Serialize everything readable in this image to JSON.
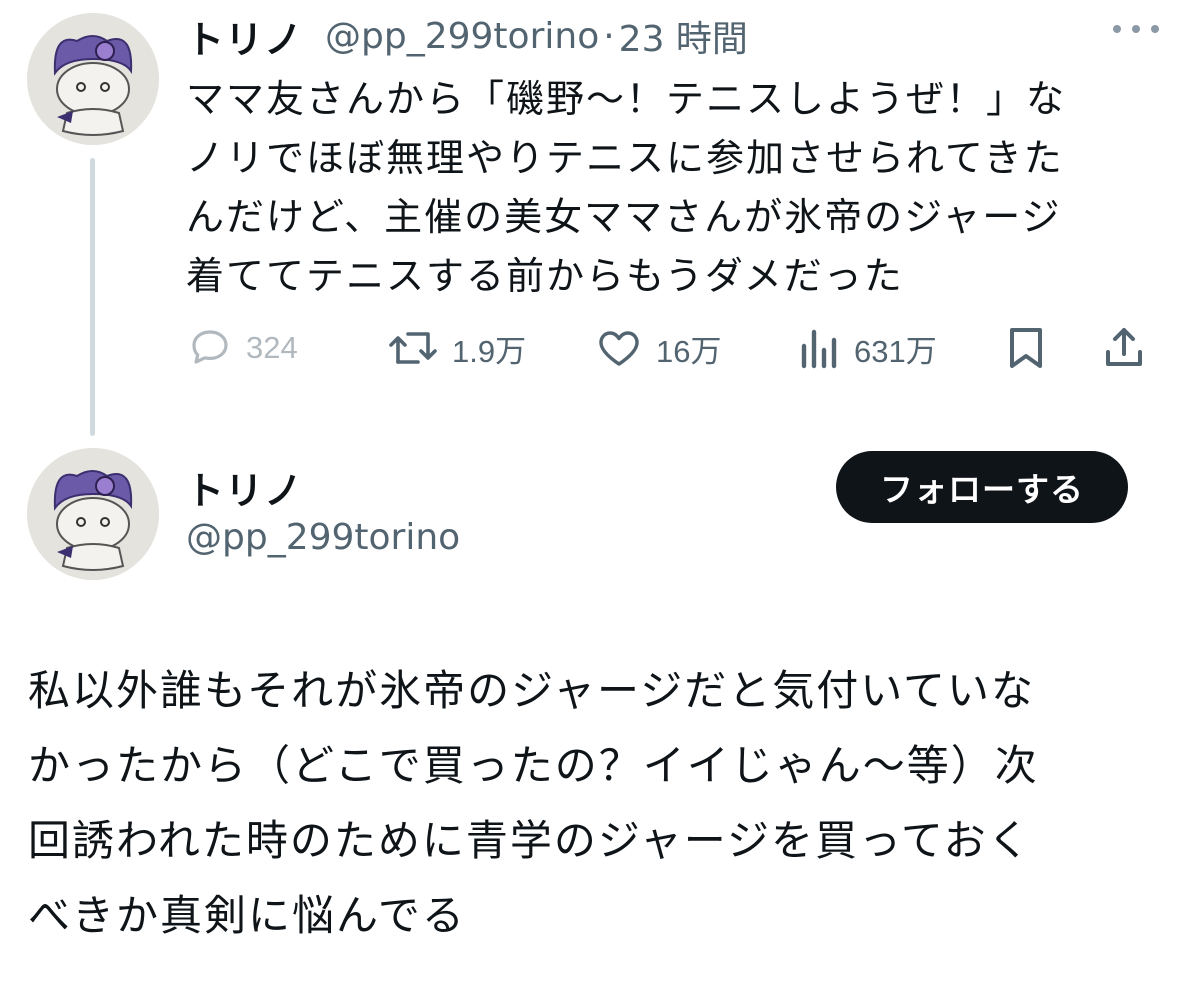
{
  "reply_tweet": {
    "display_name": "トリノ",
    "handle": "@pp_299torino",
    "separator": "·",
    "time": "23 時間",
    "text_lines": [
      "ママ友さんから「磯野〜！テニスしようぜ！」な",
      "ノリでほぼ無理やりテニスに参加させられてきた",
      "んだけど、主催の美女ママさんが氷帝のジャージ",
      "着ててテニスする前からもうダメだった"
    ],
    "stats": {
      "replies": "324",
      "retweets": "1.9万",
      "likes": "16万",
      "views": "631万"
    },
    "icons": {
      "reply": "speech-bubble-icon",
      "retweet": "retweet-icon",
      "like": "heart-icon",
      "views": "bar-chart-icon",
      "bookmark": "bookmark-icon",
      "share": "share-icon",
      "more": "more-dots-icon"
    }
  },
  "main_tweet": {
    "display_name": "トリノ",
    "handle": "@pp_299torino",
    "follow_label": "フォローする",
    "text_lines": [
      "私以外誰もそれが氷帝のジャージだと気付いていな",
      "かったから（どこで買ったの？イイじゃん〜等）次",
      "回誘われた時のために青学のジャージを買っておく",
      "べきか真剣に悩んでる"
    ]
  },
  "colors": {
    "text": "#0f1419",
    "secondary": "#536471",
    "thread_line": "#cfd9de",
    "follow_button": "#0f1419"
  }
}
